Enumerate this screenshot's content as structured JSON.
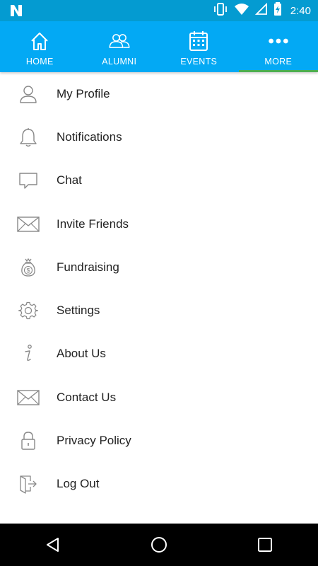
{
  "status_bar": {
    "time": "2:40",
    "icons": [
      "n-notification-icon",
      "vibrate-icon",
      "wifi-icon",
      "signal-icon",
      "battery-charging-icon"
    ]
  },
  "nav": {
    "tabs": [
      {
        "label": "HOME",
        "icon": "home-icon"
      },
      {
        "label": "ALUMNI",
        "icon": "people-icon"
      },
      {
        "label": "EVENTS",
        "icon": "calendar-icon"
      },
      {
        "label": "MORE",
        "icon": "more-dots-icon"
      }
    ],
    "active_index": 3,
    "background": "#03a9f4",
    "active_indicator": "#4caf50"
  },
  "menu": {
    "items": [
      {
        "label": "My Profile",
        "icon": "user-icon"
      },
      {
        "label": "Notifications",
        "icon": "bell-icon"
      },
      {
        "label": "Chat",
        "icon": "chat-bubble-icon"
      },
      {
        "label": "Invite Friends",
        "icon": "envelope-icon"
      },
      {
        "label": "Fundraising",
        "icon": "money-bag-icon"
      },
      {
        "label": "Settings",
        "icon": "gear-icon"
      },
      {
        "label": "About Us",
        "icon": "info-icon"
      },
      {
        "label": "Contact Us",
        "icon": "envelope-icon"
      },
      {
        "label": "Privacy Policy",
        "icon": "lock-icon"
      },
      {
        "label": "Log Out",
        "icon": "logout-icon"
      }
    ]
  },
  "system_nav": {
    "buttons": [
      "back-icon",
      "home-circle-icon",
      "recents-square-icon"
    ]
  }
}
